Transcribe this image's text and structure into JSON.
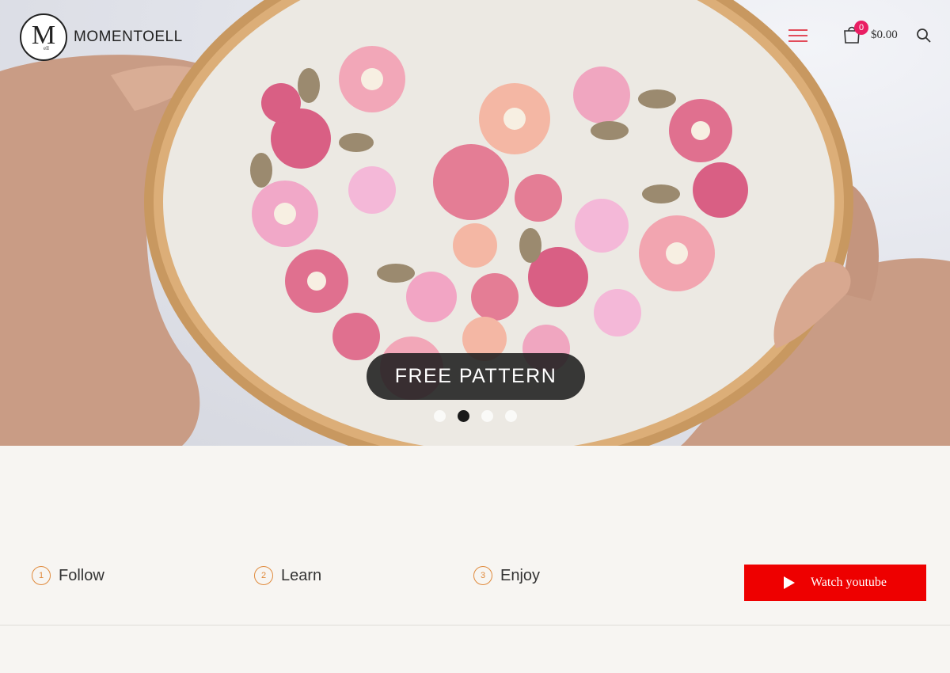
{
  "brand": {
    "logo_letter": "M",
    "logo_small": "ell",
    "name": "MOMENTOELL"
  },
  "header": {
    "menu_icon": "hamburger-icon",
    "cart_icon": "shopping-bag-icon",
    "cart_count": "0",
    "cart_total": "$0.00",
    "search_icon": "search-icon"
  },
  "hero": {
    "cta_label": "FREE PATTERN",
    "slides": 4,
    "active_slide": 2
  },
  "steps": [
    {
      "number": "1",
      "label": "Follow"
    },
    {
      "number": "2",
      "label": "Learn"
    },
    {
      "number": "3",
      "label": "Enjoy"
    }
  ],
  "youtube": {
    "label": "Watch youtube",
    "icon": "play-icon"
  },
  "colors": {
    "accent": "#e24b5a",
    "badge": "#e91e63",
    "step": "#e08a3c",
    "youtube": "#ee0000"
  }
}
